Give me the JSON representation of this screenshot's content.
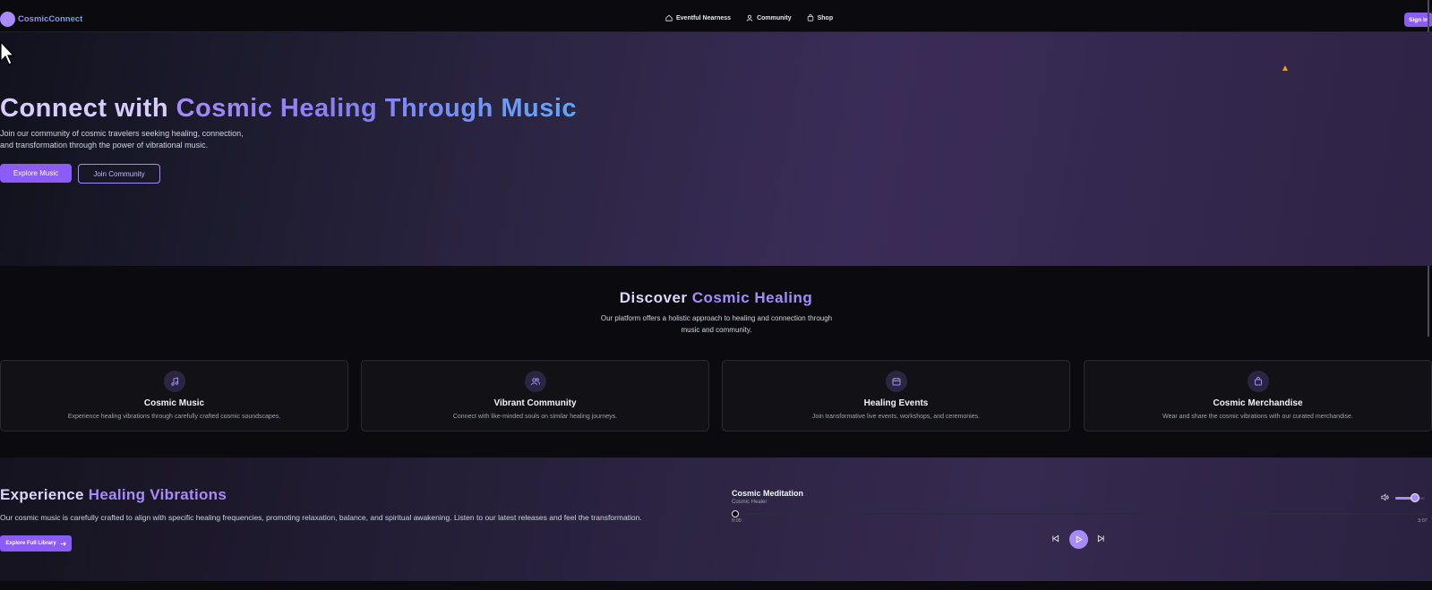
{
  "nav": {
    "logo_text": "CosmicConnect",
    "links": [
      {
        "label": "Eventful Nearness",
        "icon": "home-icon"
      },
      {
        "label": "Community",
        "icon": "user-icon"
      },
      {
        "label": "Shop",
        "icon": "shopping-bag-icon"
      }
    ],
    "signin_label": "Sign In"
  },
  "hero": {
    "title_plain": "Connect with ",
    "title_gradient": "Cosmic Healing Through Music",
    "description_line1": "Join our community of cosmic travelers seeking healing, connection,",
    "description_line2": "and transformation through the power of vibrational music.",
    "primary_button": "Explore Music",
    "secondary_button": "Join Community"
  },
  "discover": {
    "title_plain": "Discover ",
    "title_accent": "Cosmic Healing",
    "description_line1": "Our platform offers a holistic approach to healing and connection through",
    "description_line2": "music and community.",
    "cards": [
      {
        "title": "Cosmic Music",
        "description": "Experience healing vibrations through carefully crafted cosmic soundscapes.",
        "icon": "music-note-icon"
      },
      {
        "title": "Vibrant Community",
        "description": "Connect with like-minded souls on similar healing journeys.",
        "icon": "users-icon"
      },
      {
        "title": "Healing Events",
        "description": "Join transformative live events, workshops, and ceremonies.",
        "icon": "calendar-icon"
      },
      {
        "title": "Cosmic Merchandise",
        "description": "Wear and share the cosmic vibrations with our curated merchandise.",
        "icon": "shopping-bag-icon"
      }
    ]
  },
  "music": {
    "title_plain": "Experience ",
    "title_accent": "Healing Vibrations",
    "description": "Our cosmic music is carefully crafted to align with specific healing frequencies, promoting relaxation, balance, and spiritual awakening. Listen to our latest releases and feel the transformation.",
    "library_button": "Explore Full Library"
  },
  "player": {
    "track_title": "Cosmic Meditation",
    "artist": "Cosmic Healer",
    "current_time": "0:00",
    "duration": "3:07",
    "progress": 0,
    "volume": 0.7
  },
  "colors": {
    "accent": "#8b5cf6",
    "accent_light": "#a78bfa",
    "blue": "#60a5fa",
    "background": "#0b0b0f"
  }
}
